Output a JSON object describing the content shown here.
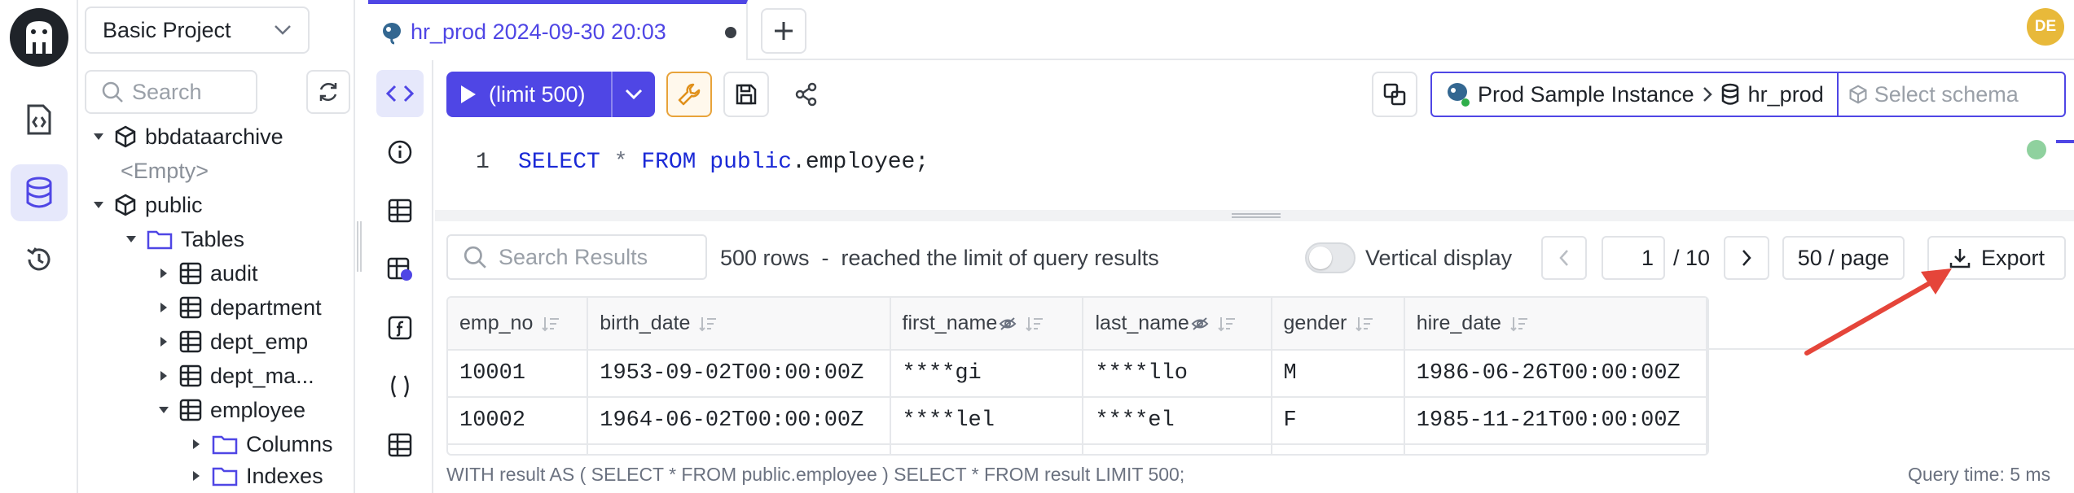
{
  "sidebar": {
    "project": "Basic Project",
    "search_placeholder": "Search",
    "tree": [
      {
        "label": "bbdataarchive"
      },
      {
        "label": "<Empty>"
      },
      {
        "label": "public"
      },
      {
        "label": "Tables"
      },
      {
        "label": "audit"
      },
      {
        "label": "department"
      },
      {
        "label": "dept_emp"
      },
      {
        "label": "dept_ma..."
      },
      {
        "label": "employee"
      },
      {
        "label": "Columns"
      },
      {
        "label": "Indexes"
      }
    ]
  },
  "tab": {
    "title": "hr_prod 2024-09-30 20:03"
  },
  "user": {
    "initials": "DE"
  },
  "toolbar": {
    "run_label": "(limit 500)",
    "instance": "Prod Sample Instance",
    "database": "hr_prod",
    "schema_placeholder": "Select schema"
  },
  "editor": {
    "line_number": "1",
    "kw_select": "SELECT",
    "star": "*",
    "kw_from": "FROM",
    "schema": "public",
    "table": ".employee;"
  },
  "results": {
    "search_placeholder": "Search Results",
    "rows_info": "500 rows  -  reached the limit of query results",
    "vertical_display": "Vertical display",
    "page": "1",
    "page_total": "/ 10",
    "page_size": "50 / page",
    "export": "Export",
    "columns": [
      "emp_no",
      "birth_date",
      "first_name",
      "last_name",
      "gender",
      "hire_date"
    ],
    "rows": [
      [
        "10001",
        "1953-09-02T00:00:00Z",
        "****gi",
        "****llo",
        "M",
        "1986-06-26T00:00:00Z"
      ],
      [
        "10002",
        "1964-06-02T00:00:00Z",
        "****lel",
        "****el",
        "F",
        "1985-11-21T00:00:00Z"
      ]
    ]
  },
  "footer": {
    "sql": "WITH result AS ( SELECT * FROM public.employee ) SELECT * FROM result LIMIT 500;",
    "query_time": "Query time: 5 ms"
  },
  "colors": {
    "accent": "#4f46e5",
    "annotation_arrow": "#e5453a",
    "avatar": "#e8b93a"
  },
  "icons": [
    "bytebase-logo-icon",
    "sql-editor-icon",
    "database-icon",
    "history-icon",
    "search-icon",
    "refresh-icon",
    "chevron-down-icon",
    "cube-icon",
    "folder-icon",
    "table-icon",
    "postgres-icon",
    "plus-icon",
    "play-icon",
    "wrench-icon",
    "save-icon",
    "share-icon",
    "copy-icon",
    "sort-icon",
    "eye-off-icon",
    "download-icon",
    "chevron-left-icon",
    "chevron-right-icon"
  ]
}
